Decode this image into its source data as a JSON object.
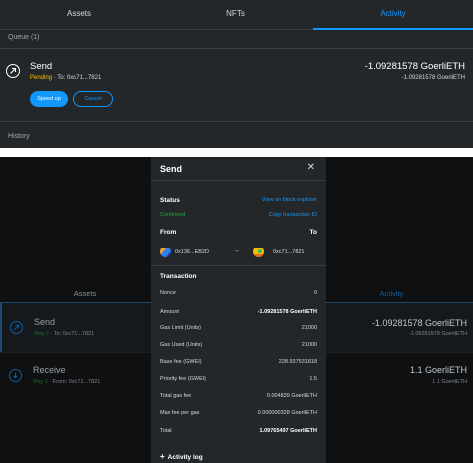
{
  "top": {
    "tabs": [
      "Assets",
      "NFTs",
      "Activity"
    ],
    "queue_label": "Queue (1)",
    "history_label": "History",
    "pending_tx": {
      "title": "Send",
      "status": "Pending",
      "to": " · To: 0xc71...7821",
      "amount": "-1.09281578 GoerliETH",
      "amount_sub": "-1.09281578 GoerliETH",
      "speed_up_label": "Speed up",
      "cancel_label": "Cancel"
    }
  },
  "bottom": {
    "tabs": [
      "Assets",
      "Activity"
    ],
    "rows": [
      {
        "title": "Send",
        "date": "May 2",
        "detail": " · To: 0xc71...7821",
        "amount": "-1.09281578 GoerliETH",
        "amount_sub": "-1.09281578 GoerliETH"
      },
      {
        "title": "Receive",
        "date": "May 2",
        "detail": " · From: 0xc71...7821",
        "amount": "1.1 GoerliETH",
        "amount_sub": "1.1 GoerliETH"
      }
    ]
  },
  "modal": {
    "title": "Send",
    "status_label": "Status",
    "status_value": "Confirmed",
    "view_explorer": "View on block explorer",
    "copy_id": "Copy transaction ID",
    "from_label": "From",
    "to_label": "To",
    "from_addr": "0x136...EB2D",
    "to_addr": "0xc71...7821",
    "transaction_label": "Transaction",
    "fields": [
      {
        "label": "Nonce",
        "value": "0"
      },
      {
        "label": "Amount",
        "value": "-1.09281578 GoerliETH"
      },
      {
        "label": "Gas Limit (Units)",
        "value": "21000"
      },
      {
        "label": "Gas Used (Units)",
        "value": "21000"
      },
      {
        "label": "Base fee (GWEI)",
        "value": "228.937531818"
      },
      {
        "label": "Priority fee (GWEI)",
        "value": "1.5"
      },
      {
        "label": "Total gas fee",
        "value": "0.004839 GoerliETH"
      },
      {
        "label": "Max fee per gas",
        "value": "0.000000328 GoerliETH"
      },
      {
        "label": "Total",
        "value": "1.09765497 GoerliETH"
      }
    ],
    "activity_log": "Activity log"
  },
  "colors": {
    "accent": "#1098fc",
    "pending": "#f8c000",
    "confirmed": "#28a745",
    "panel": "#24272a"
  }
}
